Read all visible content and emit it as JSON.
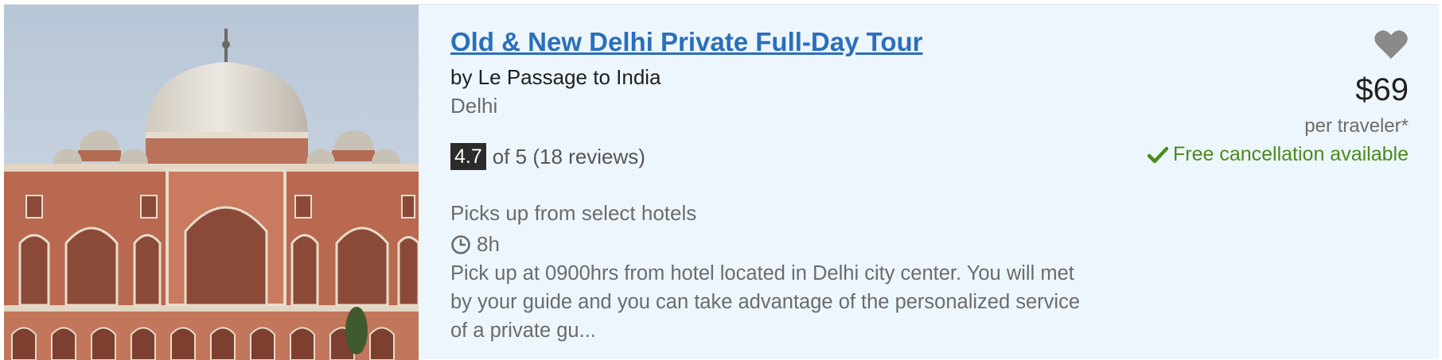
{
  "product": {
    "title": "Old & New Delhi Private Full-Day Tour",
    "operator": "by Le Passage to India",
    "location": "Delhi",
    "rating_score": "4.7",
    "rating_text": "of 5 (18 reviews)",
    "pickup": "Picks up from select hotels",
    "duration": "8h",
    "description": "Pick up at 0900hrs from hotel located in Delhi city center. You will met by your guide and you can take advantage of the personalized service of a private gu...",
    "image_alt": "Humayun's Tomb",
    "price": "$69",
    "price_unit": "per traveler*",
    "cancellation": "Free cancellation available"
  },
  "icons": {
    "favorite": "heart-icon",
    "duration": "clock-icon",
    "cancellation": "checkmark-icon"
  },
  "colors": {
    "title_link": "#2a6fba",
    "card_background": "#eef6fd",
    "cancellation_green": "#4b8a1c",
    "rating_badge": "#2b2b2b",
    "heart_grey": "#8a8a8a"
  }
}
